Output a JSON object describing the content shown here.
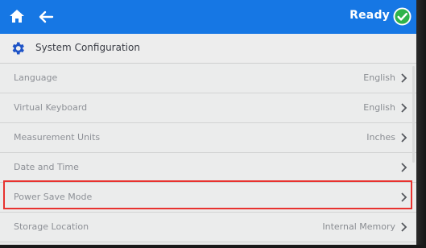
{
  "topbar": {
    "status_label": "Ready",
    "status_color": "#2fb34a",
    "bar_color": "#1677e4"
  },
  "header": {
    "title": "System Configuration"
  },
  "settings": [
    {
      "label": "Language",
      "value": "English"
    },
    {
      "label": "Virtual Keyboard",
      "value": "English"
    },
    {
      "label": "Measurement Units",
      "value": "Inches"
    },
    {
      "label": "Date and Time",
      "value": ""
    },
    {
      "label": "Power Save Mode",
      "value": ""
    },
    {
      "label": "Storage Location",
      "value": "Internal Memory"
    }
  ],
  "highlight_color": "#e8322f"
}
